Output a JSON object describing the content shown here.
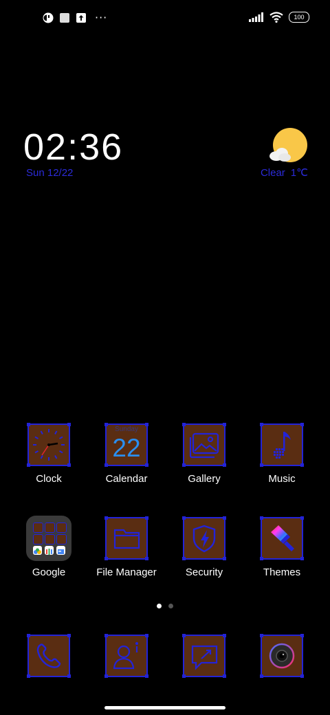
{
  "statusbar": {
    "left_icons": [
      "app-notification-icon",
      "square-notification-icon",
      "upload-notification-icon"
    ],
    "more": "···",
    "battery": "100"
  },
  "clock_widget": {
    "time": "02:36",
    "date": "Sun 12/22"
  },
  "weather_widget": {
    "condition": "Clear",
    "temperature": "1℃"
  },
  "apps": {
    "clock": "Clock",
    "calendar": "Calendar",
    "calendar_day": "Sunday",
    "calendar_date": "22",
    "gallery": "Gallery",
    "music": "Music",
    "google": "Google",
    "file_manager": "File Manager",
    "security": "Security",
    "themes": "Themes"
  },
  "colors": {
    "accent_blue": "#2323d8",
    "tile_brown": "#5a2d12",
    "calendar_blue": "#2a8ff0"
  },
  "pages": {
    "current": 1,
    "total": 2
  }
}
